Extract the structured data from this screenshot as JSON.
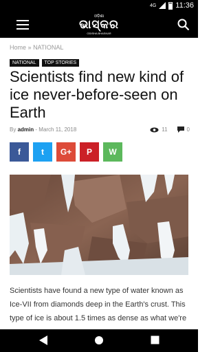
{
  "status": {
    "time": "11:36",
    "network": "4G"
  },
  "header": {
    "logo_small": "ଓଡ଼ିଶା",
    "logo_big": "ଭାସ୍କର",
    "logo_tag": "ODISHA BHASKAR"
  },
  "breadcrumb": {
    "home": "Home",
    "separator": "»",
    "section": "NATIONAL"
  },
  "tags": [
    "NATIONAL",
    "TOP STORIES"
  ],
  "article": {
    "title": "Scientists find new kind of ice never-before-seen on Earth",
    "by": "By",
    "author": "admin",
    "dash": "-",
    "date": "March 11, 2018",
    "views": "11",
    "comments": "0",
    "body": "Scientists have found a new type of water known as Ice-VII from diamonds deep in the Earth's crust. This type of ice is about 1.5 times as dense as what we're"
  },
  "share": {
    "facebook": "f",
    "twitter": "t",
    "google": "G+",
    "pinterest": "P",
    "whatsapp": "W"
  },
  "colors": {
    "facebook": "#3b5998",
    "twitter": "#1da1f2",
    "google": "#dd4b39",
    "pinterest": "#cb2027",
    "whatsapp": "#5cb85c"
  }
}
